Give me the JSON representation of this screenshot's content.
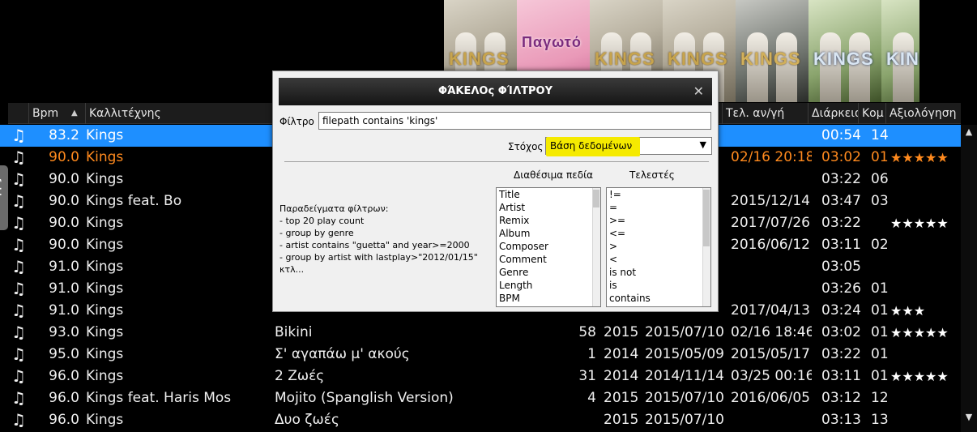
{
  "covers": [
    {
      "text": "KINGS",
      "style": ""
    },
    {
      "text": "Παγωτό",
      "style": "pink"
    },
    {
      "text": "KINGS",
      "style": ""
    },
    {
      "text": "KINGS",
      "style": ""
    },
    {
      "text": "KINGS",
      "style": "dark"
    },
    {
      "text": "KINGS",
      "style": "green"
    },
    {
      "text": "KINGS",
      "style": "green"
    }
  ],
  "sidebar": {
    "folders_tab": "folders"
  },
  "columns": {
    "bpm": "Bpm",
    "artist": "Καλλιτέχνης",
    "last_played": "Τελ. αν/γή",
    "duration": "Διάρκεια",
    "comment": "Κομ",
    "rating": "Αξιολόγηση"
  },
  "rows": [
    {
      "bpm": "83.2",
      "artist": "Kings",
      "title": "",
      "plays": "",
      "year": "",
      "added": "",
      "last": "",
      "dur": "00:54",
      "cnt": "14",
      "stars": "",
      "state": "selected"
    },
    {
      "bpm": "90.0",
      "artist": "Kings",
      "title": "",
      "plays": "",
      "year": "",
      "added": "",
      "last": "02/16 20:18",
      "dur": "03:02",
      "cnt": "01",
      "stars": "★★★★★",
      "state": "playing"
    },
    {
      "bpm": "90.0",
      "artist": "Kings",
      "title": "",
      "plays": "",
      "year": "",
      "added": "",
      "last": "",
      "dur": "03:22",
      "cnt": "06",
      "stars": "",
      "state": ""
    },
    {
      "bpm": "90.0",
      "artist": "Kings feat. Bo",
      "title": "",
      "plays": "",
      "year": "",
      "added": "",
      "last": "2015/12/14",
      "dur": "03:47",
      "cnt": "03",
      "stars": "",
      "state": ""
    },
    {
      "bpm": "90.0",
      "artist": "Kings",
      "title": "",
      "plays": "",
      "year": "",
      "added": "",
      "last": "2017/07/26",
      "dur": "03:22",
      "cnt": "",
      "stars": "★★★★★",
      "state": ""
    },
    {
      "bpm": "90.0",
      "artist": "Kings",
      "title": "",
      "plays": "",
      "year": "",
      "added": "",
      "last": "2016/06/12",
      "dur": "03:11",
      "cnt": "02",
      "stars": "",
      "state": ""
    },
    {
      "bpm": "91.0",
      "artist": "Kings",
      "title": "",
      "plays": "",
      "year": "",
      "added": "",
      "last": "",
      "dur": "03:05",
      "cnt": "",
      "stars": "",
      "state": ""
    },
    {
      "bpm": "91.0",
      "artist": "Kings",
      "title": "",
      "plays": "",
      "year": "",
      "added": "",
      "last": "",
      "dur": "03:26",
      "cnt": "01",
      "stars": "",
      "state": ""
    },
    {
      "bpm": "91.0",
      "artist": "Kings",
      "title": "",
      "plays": "",
      "year": "",
      "added": "",
      "last": "2017/04/13",
      "dur": "03:24",
      "cnt": "01",
      "stars": "★★★",
      "state": ""
    },
    {
      "bpm": "93.0",
      "artist": "Kings",
      "title": "Bikini",
      "plays": "58",
      "year": "2015",
      "added": "2015/07/10",
      "last": "02/16 18:46",
      "dur": "03:02",
      "cnt": "01",
      "stars": "★★★★★",
      "state": ""
    },
    {
      "bpm": "95.0",
      "artist": "Kings",
      "title": "Σ' αγαπάω μ' ακούς",
      "plays": "1",
      "year": "2014",
      "added": "2015/05/09",
      "last": "2015/05/17",
      "dur": "03:22",
      "cnt": "01",
      "stars": "",
      "state": ""
    },
    {
      "bpm": "96.0",
      "artist": "Kings",
      "title": "2 Ζωές",
      "plays": "31",
      "year": "2014",
      "added": "2014/11/14",
      "last": "03/25 00:16",
      "dur": "03:11",
      "cnt": "01",
      "stars": "★★★★★",
      "state": ""
    },
    {
      "bpm": "96.0",
      "artist": "Kings feat. Haris Mos",
      "title": "Mojito (Spanglish Version)",
      "plays": "4",
      "year": "2015",
      "added": "2015/07/10",
      "last": "2016/06/05",
      "dur": "03:12",
      "cnt": "12",
      "stars": "",
      "state": ""
    },
    {
      "bpm": "96.0",
      "artist": "Kings",
      "title": "Δυο ζωές",
      "plays": "",
      "year": "2015",
      "added": "2015/07/10",
      "last": "",
      "dur": "03:13",
      "cnt": "13",
      "stars": "",
      "state": ""
    }
  ],
  "dialog": {
    "title": "ΦΆΚΕΛΟς ΦΊΛΤΡΟΥ",
    "filter_label": "Φίλτρο :",
    "filter_value": "filepath contains 'kings'",
    "target_label": "Στόχος :",
    "target_value": "Βάση δεδομένων",
    "fields_header": "Διαθέσιμα πεδία",
    "ops_header": "Τελεστές",
    "examples": [
      "Παραδείγματα φίλτρων:",
      "- top 20 play count",
      "- group by genre",
      "- artist contains \"guetta\" and year>=2000",
      "- group by artist with lastplay>\"2012/01/15\"",
      "κτλ..."
    ],
    "fields": [
      "Title",
      "Artist",
      "Remix",
      "Album",
      "Composer",
      "Comment",
      "Genre",
      "Length",
      "BPM"
    ],
    "operators": [
      "!=",
      "=",
      ">=",
      "<=",
      ">",
      "<",
      "is not",
      "is",
      "contains"
    ]
  },
  "colors": {
    "selection": "#1e8fff",
    "playing": "#ff8a1e",
    "highlight": "#f5ea00"
  }
}
